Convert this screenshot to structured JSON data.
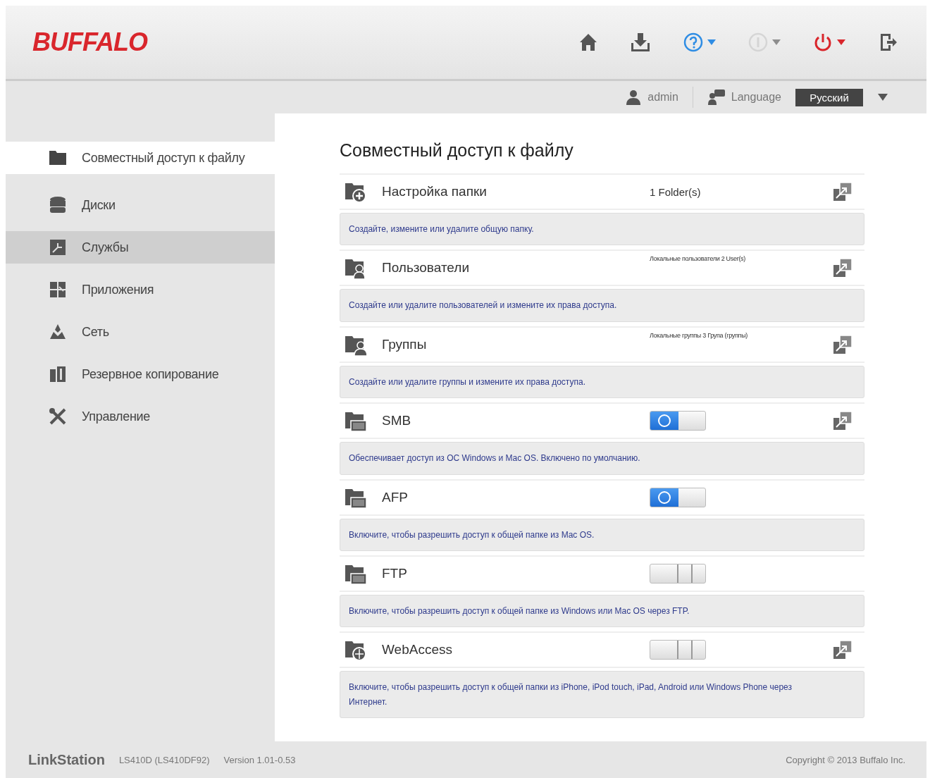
{
  "header": {
    "logo": "BUFFALO",
    "icons": [
      {
        "kind": "home",
        "disabled": false
      },
      {
        "kind": "download",
        "disabled": false
      },
      {
        "kind": "help",
        "disabled": false
      },
      {
        "kind": "info",
        "disabled": true
      },
      {
        "kind": "power",
        "disabled": false
      },
      {
        "kind": "logout",
        "disabled": false
      }
    ]
  },
  "user_bar": {
    "user": "admin",
    "language_label": "Language",
    "language": "Русский"
  },
  "sidebar": {
    "items": [
      {
        "label": "Совместный доступ к файлу",
        "selected": true,
        "highlighted": false
      },
      {
        "label": "Диски",
        "selected": false,
        "highlighted": false
      },
      {
        "label": "Службы",
        "selected": false,
        "highlighted": true
      },
      {
        "label": "Приложения",
        "selected": false,
        "highlighted": false
      },
      {
        "label": "Сеть",
        "selected": false,
        "highlighted": false
      },
      {
        "label": "Резервное копирование",
        "selected": false,
        "highlighted": false
      },
      {
        "label": "Управление",
        "selected": false,
        "highlighted": false
      }
    ]
  },
  "content": {
    "title": "Совместный доступ к файлу",
    "rows": [
      {
        "kind": "info",
        "name": "Настройка папки",
        "info": "1 Folder(s)",
        "settings": true,
        "description": "Создайте, измените или удалите общую папку."
      },
      {
        "kind": "info",
        "name": "Пользователи",
        "info": "Локальные пользователи 2 User(s)",
        "settings": true,
        "description": "Создайте или удалите пользователей и измените их права доступа."
      },
      {
        "kind": "info",
        "name": "Группы",
        "info": "Локальные группы 3 Група (группы)",
        "settings": true,
        "description": "Создайте или удалите группы и измените их права доступа."
      },
      {
        "kind": "toggle",
        "name": "SMB",
        "on": true,
        "settings": true,
        "description": "Обеспечивает доступ из ОС Windows и Mac OS. Включено по умолчанию."
      },
      {
        "kind": "toggle",
        "name": "AFP",
        "on": true,
        "settings": false,
        "description": "Включите, чтобы разрешить доступ к общей папке из Mac OS."
      },
      {
        "kind": "toggle",
        "name": "FTP",
        "on": false,
        "settings": false,
        "description": "Включите, чтобы разрешить доступ к общей папке из Windows или Mac OS через FTP."
      },
      {
        "kind": "toggle",
        "name": "WebAccess",
        "on": false,
        "settings": true,
        "description": "Включите, чтобы разрешить доступ к общей папки из iPhone, iPod touch, iPad, Android или Windows Phone через Интернет."
      }
    ]
  },
  "footer": {
    "product": "LinkStation",
    "model": "LS410D (LS410DF92)",
    "version": "Version 1.01-0.53",
    "copyright": "Copyright © 2013 Buffalo Inc."
  }
}
